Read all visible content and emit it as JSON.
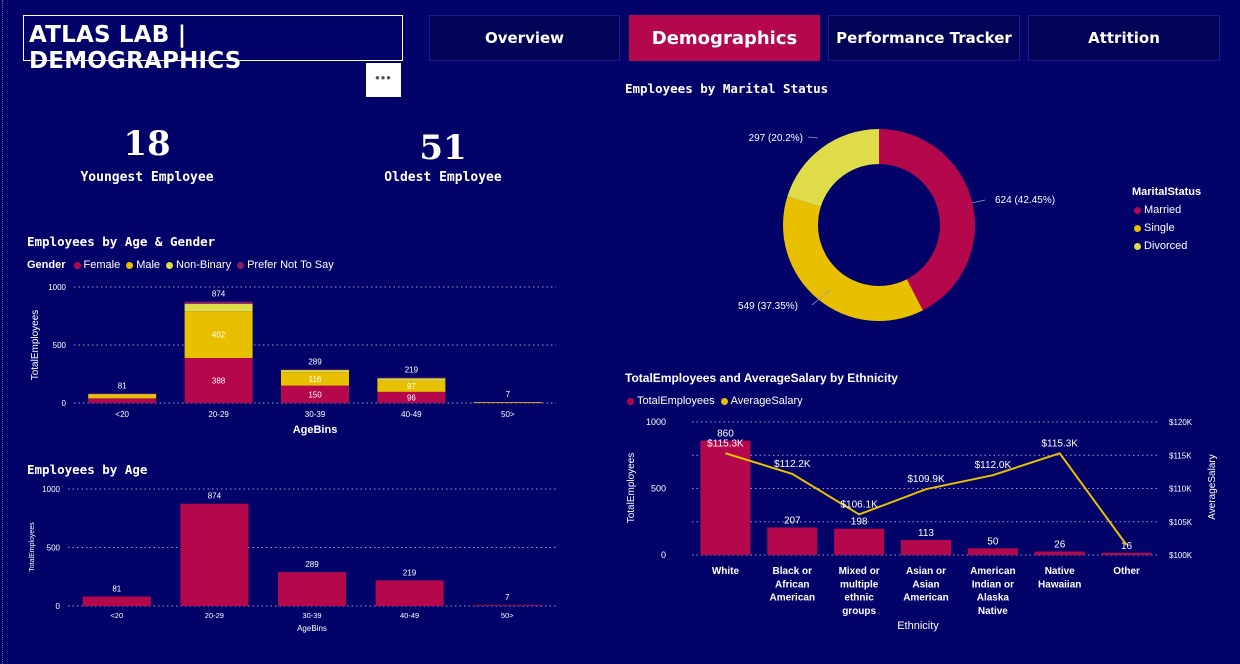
{
  "header": {
    "title": "ATLAS LAB | DEMOGRAPHICS",
    "more_label": "•••",
    "nav": [
      {
        "label": "Overview",
        "active": false
      },
      {
        "label": "Demographics",
        "active": true
      },
      {
        "label": "Performance Tracker",
        "active": false
      },
      {
        "label": "Attrition",
        "active": false
      }
    ]
  },
  "kpis": [
    {
      "value": "18",
      "label": "Youngest Employee"
    },
    {
      "value": "51",
      "label": "Oldest Employee"
    }
  ],
  "colors": {
    "female": "#b5074c",
    "male": "#e8c000",
    "nonbinary": "#dedc48",
    "prefer_not": "#8a1a6a",
    "salary_line": "#e8c000",
    "background": "#020268",
    "active_tab": "#b5074c"
  },
  "age_gender": {
    "title": "Employees by Age & Gender",
    "legend_title": "Gender",
    "legend": [
      "Female",
      "Male",
      "Non-Binary",
      "Prefer Not To Say"
    ],
    "ylabel": "TotalEmployees",
    "xlabel": "AgeBins",
    "yticks": [
      "1000",
      "500",
      "0"
    ]
  },
  "by_age": {
    "title": "Employees by Age",
    "ylabel": "TotalEmployees",
    "xlabel": "AgeBins",
    "yticks": [
      "1000",
      "500",
      "0"
    ]
  },
  "marital": {
    "title": "Employees by Marital Status",
    "legend_title": "MaritalStatus",
    "legend": [
      "Married",
      "Single",
      "Divorced"
    ]
  },
  "ethnicity": {
    "title": "TotalEmployees and AverageSalary by Ethnicity",
    "legend": [
      "TotalEmployees",
      "AverageSalary"
    ],
    "ylabel_left": "TotalEmployees",
    "ylabel_right": "AverageSalary",
    "xlabel": "Ethnicity",
    "yticks_left": [
      "1000",
      "500",
      "0"
    ],
    "yticks_right": [
      "$120K",
      "$115K",
      "$110K",
      "$105K",
      "$100K"
    ]
  },
  "chart_data": [
    {
      "type": "bar",
      "title": "Employees by Age & Gender",
      "stacked": true,
      "categories": [
        "<20",
        "20-29",
        "30-39",
        "40-49",
        "50>"
      ],
      "totals": [
        81,
        874,
        289,
        219,
        7
      ],
      "series": [
        {
          "name": "Female",
          "values": [
            40,
            388,
            150,
            96,
            3
          ],
          "labels": [
            "",
            "388",
            "150",
            "96",
            ""
          ]
        },
        {
          "name": "Male",
          "values": [
            30,
            402,
            116,
            97,
            3
          ],
          "labels": [
            "",
            "402",
            "116",
            "97",
            ""
          ]
        },
        {
          "name": "Non-Binary",
          "values": [
            8,
            66,
            18,
            20,
            1
          ],
          "labels": [
            "",
            "",
            "",
            "",
            ""
          ]
        },
        {
          "name": "Prefer Not To Say",
          "values": [
            3,
            18,
            5,
            6,
            0
          ],
          "labels": [
            "",
            "",
            "",
            "",
            ""
          ]
        }
      ],
      "ylim": [
        0,
        1000
      ]
    },
    {
      "type": "bar",
      "title": "Employees by Age",
      "categories": [
        "<20",
        "20-29",
        "30-39",
        "40-49",
        "50>"
      ],
      "values": [
        81,
        874,
        289,
        219,
        7
      ],
      "ylim": [
        0,
        1000
      ]
    },
    {
      "type": "pie",
      "title": "Employees by Marital Status",
      "donut": true,
      "categories": [
        "Married",
        "Single",
        "Divorced"
      ],
      "values": [
        624,
        549,
        297
      ],
      "labels": [
        "624 (42.45%)",
        "549 (37.35%)",
        "297 (20.2%)"
      ]
    },
    {
      "type": "bar",
      "title": "TotalEmployees and AverageSalary by Ethnicity",
      "categories": [
        "White",
        "Black or African American",
        "Mixed or multiple ethnic groups",
        "Asian or Asian American",
        "American Indian or Alaska Native",
        "Native Hawaiian",
        "Other"
      ],
      "category_lines": [
        [
          "White"
        ],
        [
          "Black or",
          "African",
          "American"
        ],
        [
          "Mixed or",
          "multiple",
          "ethnic",
          "groups"
        ],
        [
          "Asian or",
          "Asian",
          "American"
        ],
        [
          "American",
          "Indian or",
          "Alaska",
          "Native"
        ],
        [
          "Native",
          "Hawaiian"
        ],
        [
          "Other"
        ]
      ],
      "series": [
        {
          "name": "TotalEmployees",
          "values": [
            860,
            207,
            198,
            113,
            50,
            26,
            16
          ]
        },
        {
          "name": "AverageSalary",
          "values": [
            115300,
            112200,
            106100,
            109900,
            112000,
            115300,
            101500
          ],
          "labels": [
            "$115.3K",
            "$112.2K",
            "$106.1K",
            "$109.9K",
            "$112.0K",
            "$115.3K",
            ""
          ]
        }
      ],
      "ylim": [
        0,
        1000
      ],
      "y2lim": [
        100000,
        120000
      ]
    }
  ]
}
